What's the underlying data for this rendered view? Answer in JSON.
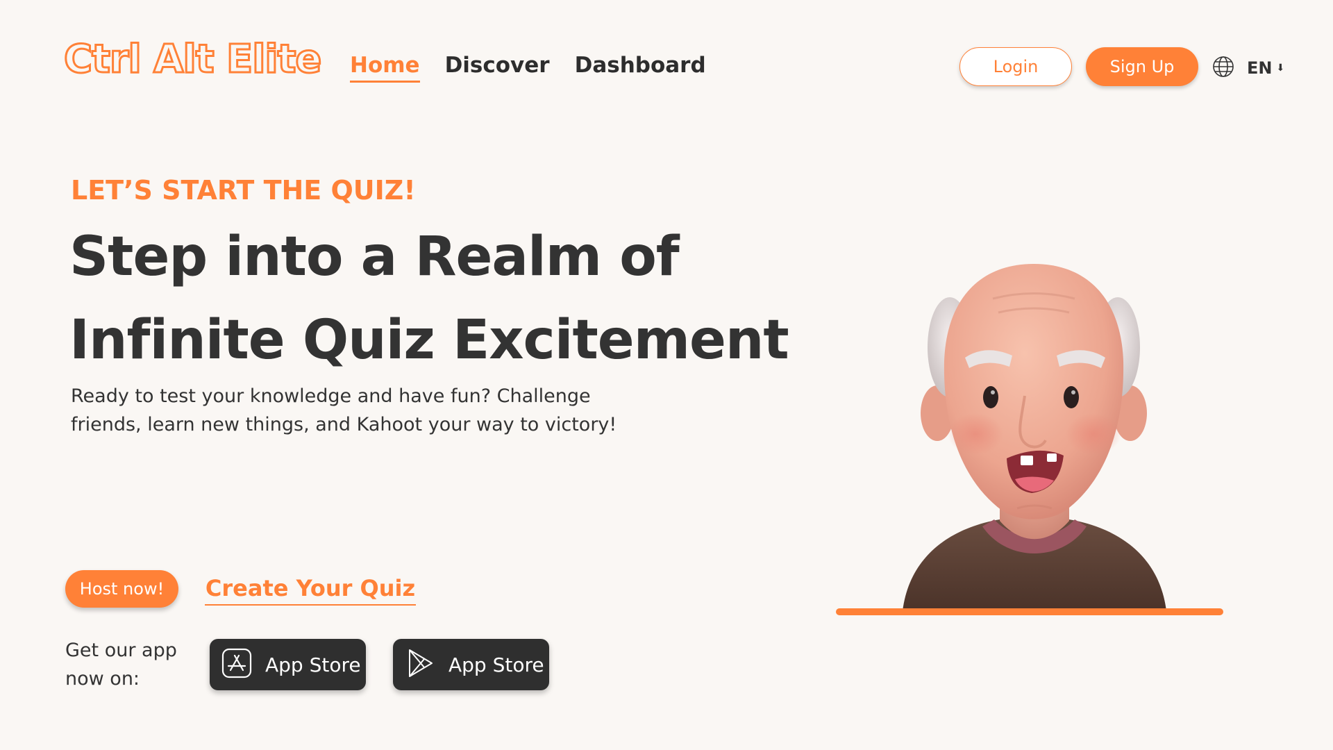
{
  "brand": {
    "name": "Ctrl Alt Elite",
    "accent_color": "#ff8137"
  },
  "nav": {
    "items": [
      {
        "label": "Home",
        "active": true
      },
      {
        "label": "Discover",
        "active": false
      },
      {
        "label": "Dashboard",
        "active": false
      }
    ]
  },
  "auth": {
    "login_label": "Login",
    "signup_label": "Sign Up"
  },
  "language": {
    "icon": "globe-icon",
    "code": "EN",
    "arrow_icon": "arrow-down-icon"
  },
  "hero": {
    "eyebrow": "LET’S START THE QUIZ!",
    "title_line1": "Step into a Realm of",
    "title_line2": "Infinite Quiz Excitement",
    "description": "Ready to test your knowledge and have fun? Challenge friends, learn new things, and Kahoot your way to victory!"
  },
  "cta": {
    "host_label": "Host now!",
    "create_label": "Create Your Quiz"
  },
  "app_download": {
    "text": "Get our app now on:",
    "stores": [
      {
        "label": "App Store",
        "icon": "app-store-icon"
      },
      {
        "label": "App Store",
        "icon": "google-play-icon"
      }
    ]
  },
  "illustration": {
    "icon": "old-man-avatar-icon"
  }
}
